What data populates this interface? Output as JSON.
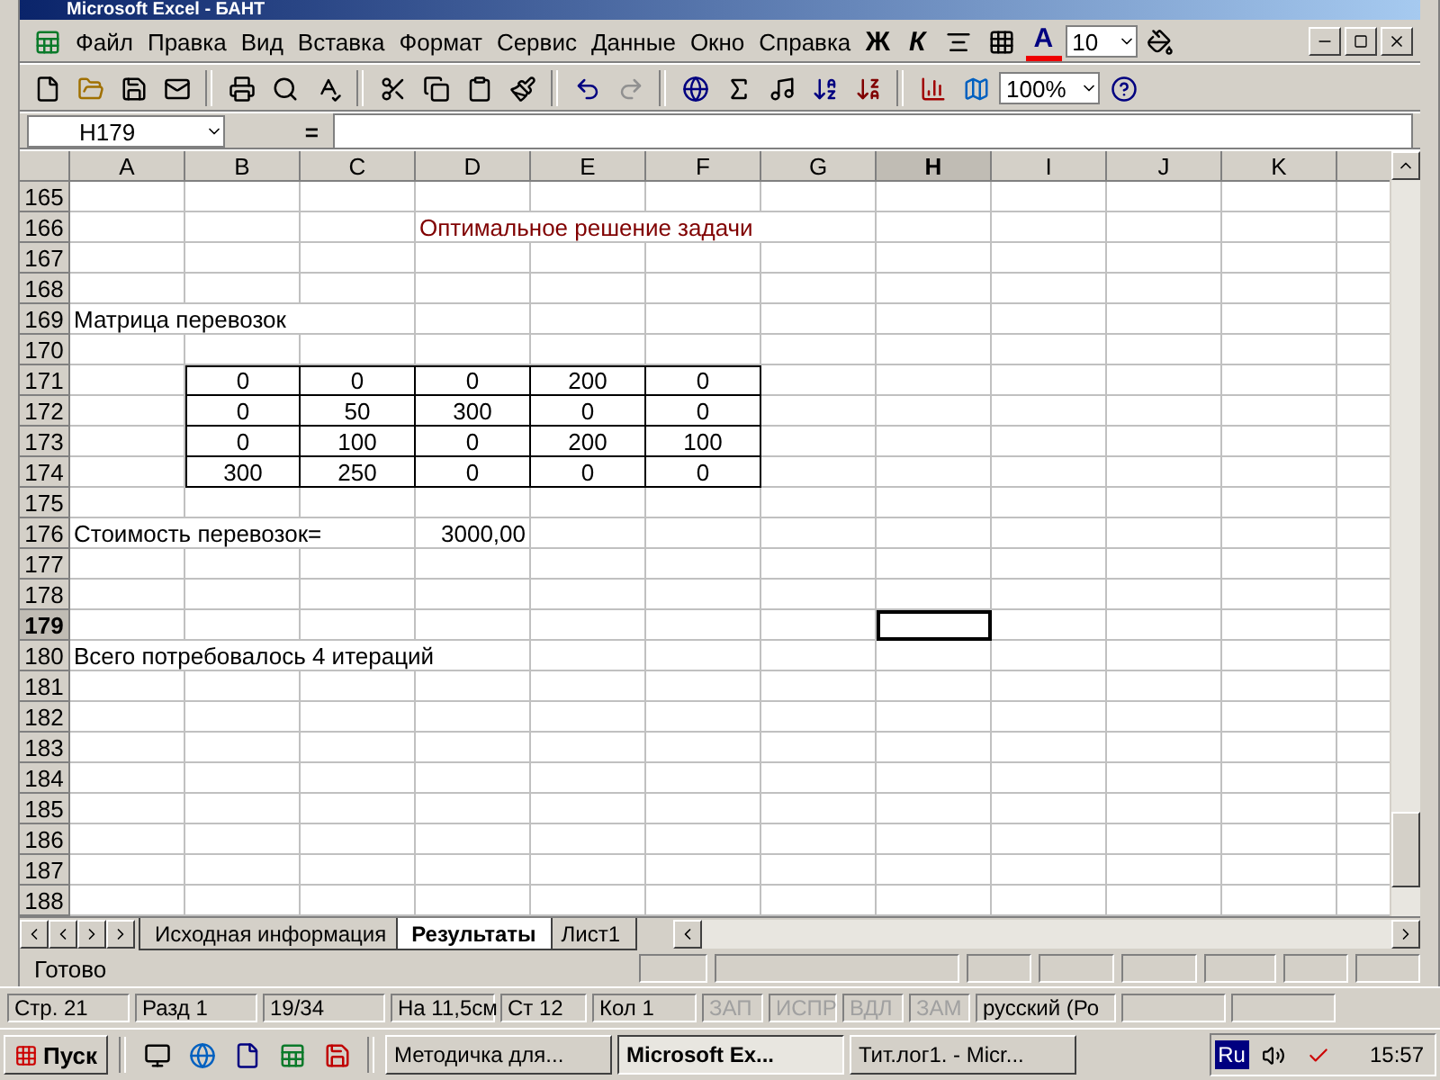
{
  "window": {
    "title": "Microsoft Excel - БАНТ"
  },
  "menu": [
    "Файл",
    "Правка",
    "Вид",
    "Вставка",
    "Формат",
    "Сервис",
    "Данные",
    "Окно",
    "Справка"
  ],
  "format_toolbar": {
    "bold": "Ж",
    "italic": "К",
    "font_color": "A",
    "font_size": "10"
  },
  "standard_toolbar": {
    "zoom": "100%"
  },
  "formula_bar": {
    "name_box": "H179",
    "equals": "="
  },
  "columns": [
    {
      "label": "A",
      "selected": false
    },
    {
      "label": "B",
      "selected": false
    },
    {
      "label": "C",
      "selected": false
    },
    {
      "label": "D",
      "selected": false
    },
    {
      "label": "E",
      "selected": false
    },
    {
      "label": "F",
      "selected": false
    },
    {
      "label": "G",
      "selected": false
    },
    {
      "label": "H",
      "selected": true
    },
    {
      "label": "I",
      "selected": false
    },
    {
      "label": "J",
      "selected": false
    },
    {
      "label": "K",
      "selected": false
    }
  ],
  "rows": [
    {
      "number": "165",
      "selected": false,
      "cells": [
        {
          "kind": "empty"
        },
        {
          "kind": "empty"
        },
        {
          "kind": "empty"
        },
        {
          "kind": "empty"
        },
        {
          "kind": "empty"
        },
        {
          "kind": "empty"
        },
        {
          "kind": "empty"
        },
        {
          "kind": "empty"
        },
        {
          "kind": "empty"
        },
        {
          "kind": "empty"
        },
        {
          "kind": "empty"
        }
      ]
    },
    {
      "number": "166",
      "selected": false,
      "cells": [
        {
          "kind": "empty"
        },
        {
          "kind": "empty"
        },
        {
          "kind": "empty"
        },
        {
          "kind": "heading",
          "text": "Оптимальное решение задачи"
        },
        {
          "kind": "empty"
        },
        {
          "kind": "empty"
        },
        {
          "kind": "empty"
        },
        {
          "kind": "empty"
        },
        {
          "kind": "empty"
        },
        {
          "kind": "empty"
        },
        {
          "kind": "empty"
        }
      ]
    },
    {
      "number": "167",
      "selected": false,
      "cells": [
        {
          "kind": "empty"
        },
        {
          "kind": "empty"
        },
        {
          "kind": "empty"
        },
        {
          "kind": "empty"
        },
        {
          "kind": "empty"
        },
        {
          "kind": "empty"
        },
        {
          "kind": "empty"
        },
        {
          "kind": "empty"
        },
        {
          "kind": "empty"
        },
        {
          "kind": "empty"
        },
        {
          "kind": "empty"
        }
      ]
    },
    {
      "number": "168",
      "selected": false,
      "cells": [
        {
          "kind": "empty"
        },
        {
          "kind": "empty"
        },
        {
          "kind": "empty"
        },
        {
          "kind": "empty"
        },
        {
          "kind": "empty"
        },
        {
          "kind": "empty"
        },
        {
          "kind": "empty"
        },
        {
          "kind": "empty"
        },
        {
          "kind": "empty"
        },
        {
          "kind": "empty"
        },
        {
          "kind": "empty"
        }
      ]
    },
    {
      "number": "169",
      "selected": false,
      "cells": [
        {
          "kind": "label",
          "text": "Матрица перевозок"
        },
        {
          "kind": "empty"
        },
        {
          "kind": "empty"
        },
        {
          "kind": "empty"
        },
        {
          "kind": "empty"
        },
        {
          "kind": "empty"
        },
        {
          "kind": "empty"
        },
        {
          "kind": "empty"
        },
        {
          "kind": "empty"
        },
        {
          "kind": "empty"
        },
        {
          "kind": "empty"
        }
      ]
    },
    {
      "number": "170",
      "selected": false,
      "cells": [
        {
          "kind": "empty"
        },
        {
          "kind": "empty"
        },
        {
          "kind": "empty"
        },
        {
          "kind": "empty"
        },
        {
          "kind": "empty"
        },
        {
          "kind": "empty"
        },
        {
          "kind": "empty"
        },
        {
          "kind": "empty"
        },
        {
          "kind": "empty"
        },
        {
          "kind": "empty"
        },
        {
          "kind": "empty"
        }
      ]
    },
    {
      "number": "171",
      "selected": false,
      "cells": [
        {
          "kind": "empty"
        },
        {
          "kind": "matrix",
          "text": "0"
        },
        {
          "kind": "matrix",
          "text": "0"
        },
        {
          "kind": "matrix",
          "text": "0"
        },
        {
          "kind": "matrix",
          "text": "200"
        },
        {
          "kind": "matrix",
          "text": "0"
        },
        {
          "kind": "empty"
        },
        {
          "kind": "empty"
        },
        {
          "kind": "empty"
        },
        {
          "kind": "empty"
        },
        {
          "kind": "empty"
        }
      ]
    },
    {
      "number": "172",
      "selected": false,
      "cells": [
        {
          "kind": "empty"
        },
        {
          "kind": "matrix",
          "text": "0"
        },
        {
          "kind": "matrix",
          "text": "50"
        },
        {
          "kind": "matrix",
          "text": "300"
        },
        {
          "kind": "matrix",
          "text": "0"
        },
        {
          "kind": "matrix",
          "text": "0"
        },
        {
          "kind": "empty"
        },
        {
          "kind": "empty"
        },
        {
          "kind": "empty"
        },
        {
          "kind": "empty"
        },
        {
          "kind": "empty"
        }
      ]
    },
    {
      "number": "173",
      "selected": false,
      "cells": [
        {
          "kind": "empty"
        },
        {
          "kind": "matrix",
          "text": "0"
        },
        {
          "kind": "matrix",
          "text": "100"
        },
        {
          "kind": "matrix",
          "text": "0"
        },
        {
          "kind": "matrix",
          "text": "200"
        },
        {
          "kind": "matrix",
          "text": "100"
        },
        {
          "kind": "empty"
        },
        {
          "kind": "empty"
        },
        {
          "kind": "empty"
        },
        {
          "kind": "empty"
        },
        {
          "kind": "empty"
        }
      ]
    },
    {
      "number": "174",
      "selected": false,
      "cells": [
        {
          "kind": "empty"
        },
        {
          "kind": "matrix",
          "text": "300"
        },
        {
          "kind": "matrix",
          "text": "250"
        },
        {
          "kind": "matrix",
          "text": "0"
        },
        {
          "kind": "matrix",
          "text": "0"
        },
        {
          "kind": "matrix",
          "text": "0"
        },
        {
          "kind": "empty"
        },
        {
          "kind": "empty"
        },
        {
          "kind": "empty"
        },
        {
          "kind": "empty"
        },
        {
          "kind": "empty"
        }
      ]
    },
    {
      "number": "175",
      "selected": false,
      "cells": [
        {
          "kind": "empty"
        },
        {
          "kind": "empty"
        },
        {
          "kind": "empty"
        },
        {
          "kind": "empty"
        },
        {
          "kind": "empty"
        },
        {
          "kind": "empty"
        },
        {
          "kind": "empty"
        },
        {
          "kind": "empty"
        },
        {
          "kind": "empty"
        },
        {
          "kind": "empty"
        },
        {
          "kind": "empty"
        }
      ]
    },
    {
      "number": "176",
      "selected": false,
      "cells": [
        {
          "kind": "label",
          "text": "Стоимость перевозок="
        },
        {
          "kind": "empty"
        },
        {
          "kind": "empty"
        },
        {
          "kind": "number",
          "text": "3000,00"
        },
        {
          "kind": "empty"
        },
        {
          "kind": "empty"
        },
        {
          "kind": "empty"
        },
        {
          "kind": "empty"
        },
        {
          "kind": "empty"
        },
        {
          "kind": "empty"
        },
        {
          "kind": "empty"
        }
      ]
    },
    {
      "number": "177",
      "selected": false,
      "cells": [
        {
          "kind": "empty"
        },
        {
          "kind": "empty"
        },
        {
          "kind": "empty"
        },
        {
          "kind": "empty"
        },
        {
          "kind": "empty"
        },
        {
          "kind": "empty"
        },
        {
          "kind": "empty"
        },
        {
          "kind": "empty"
        },
        {
          "kind": "empty"
        },
        {
          "kind": "empty"
        },
        {
          "kind": "empty"
        }
      ]
    },
    {
      "number": "178",
      "selected": false,
      "cells": [
        {
          "kind": "empty"
        },
        {
          "kind": "empty"
        },
        {
          "kind": "empty"
        },
        {
          "kind": "empty"
        },
        {
          "kind": "empty"
        },
        {
          "kind": "empty"
        },
        {
          "kind": "empty"
        },
        {
          "kind": "empty"
        },
        {
          "kind": "empty"
        },
        {
          "kind": "empty"
        },
        {
          "kind": "empty"
        }
      ]
    },
    {
      "number": "179",
      "selected": true,
      "cells": [
        {
          "kind": "empty"
        },
        {
          "kind": "empty"
        },
        {
          "kind": "empty"
        },
        {
          "kind": "empty"
        },
        {
          "kind": "empty"
        },
        {
          "kind": "empty"
        },
        {
          "kind": "empty"
        },
        {
          "kind": "empty"
        },
        {
          "kind": "empty"
        },
        {
          "kind": "empty"
        },
        {
          "kind": "empty"
        }
      ]
    },
    {
      "number": "180",
      "selected": false,
      "cells": [
        {
          "kind": "label",
          "text": "Всего потребовалось  4 итераций"
        },
        {
          "kind": "empty"
        },
        {
          "kind": "empty"
        },
        {
          "kind": "empty"
        },
        {
          "kind": "empty"
        },
        {
          "kind": "empty"
        },
        {
          "kind": "empty"
        },
        {
          "kind": "empty"
        },
        {
          "kind": "empty"
        },
        {
          "kind": "empty"
        },
        {
          "kind": "empty"
        }
      ]
    },
    {
      "number": "181",
      "selected": false,
      "cells": [
        {
          "kind": "empty"
        },
        {
          "kind": "empty"
        },
        {
          "kind": "empty"
        },
        {
          "kind": "empty"
        },
        {
          "kind": "empty"
        },
        {
          "kind": "empty"
        },
        {
          "kind": "empty"
        },
        {
          "kind": "empty"
        },
        {
          "kind": "empty"
        },
        {
          "kind": "empty"
        },
        {
          "kind": "empty"
        }
      ]
    },
    {
      "number": "182",
      "selected": false,
      "cells": [
        {
          "kind": "empty"
        },
        {
          "kind": "empty"
        },
        {
          "kind": "empty"
        },
        {
          "kind": "empty"
        },
        {
          "kind": "empty"
        },
        {
          "kind": "empty"
        },
        {
          "kind": "empty"
        },
        {
          "kind": "empty"
        },
        {
          "kind": "empty"
        },
        {
          "kind": "empty"
        },
        {
          "kind": "empty"
        }
      ]
    },
    {
      "number": "183",
      "selected": false,
      "cells": [
        {
          "kind": "empty"
        },
        {
          "kind": "empty"
        },
        {
          "kind": "empty"
        },
        {
          "kind": "empty"
        },
        {
          "kind": "empty"
        },
        {
          "kind": "empty"
        },
        {
          "kind": "empty"
        },
        {
          "kind": "empty"
        },
        {
          "kind": "empty"
        },
        {
          "kind": "empty"
        },
        {
          "kind": "empty"
        }
      ]
    },
    {
      "number": "184",
      "selected": false,
      "cells": [
        {
          "kind": "empty"
        },
        {
          "kind": "empty"
        },
        {
          "kind": "empty"
        },
        {
          "kind": "empty"
        },
        {
          "kind": "empty"
        },
        {
          "kind": "empty"
        },
        {
          "kind": "empty"
        },
        {
          "kind": "empty"
        },
        {
          "kind": "empty"
        },
        {
          "kind": "empty"
        },
        {
          "kind": "empty"
        }
      ]
    },
    {
      "number": "185",
      "selected": false,
      "cells": [
        {
          "kind": "empty"
        },
        {
          "kind": "empty"
        },
        {
          "kind": "empty"
        },
        {
          "kind": "empty"
        },
        {
          "kind": "empty"
        },
        {
          "kind": "empty"
        },
        {
          "kind": "empty"
        },
        {
          "kind": "empty"
        },
        {
          "kind": "empty"
        },
        {
          "kind": "empty"
        },
        {
          "kind": "empty"
        }
      ]
    },
    {
      "number": "186",
      "selected": false,
      "cells": [
        {
          "kind": "empty"
        },
        {
          "kind": "empty"
        },
        {
          "kind": "empty"
        },
        {
          "kind": "empty"
        },
        {
          "kind": "empty"
        },
        {
          "kind": "empty"
        },
        {
          "kind": "empty"
        },
        {
          "kind": "empty"
        },
        {
          "kind": "empty"
        },
        {
          "kind": "empty"
        },
        {
          "kind": "empty"
        }
      ]
    },
    {
      "number": "187",
      "selected": false,
      "cells": [
        {
          "kind": "empty"
        },
        {
          "kind": "empty"
        },
        {
          "kind": "empty"
        },
        {
          "kind": "empty"
        },
        {
          "kind": "empty"
        },
        {
          "kind": "empty"
        },
        {
          "kind": "empty"
        },
        {
          "kind": "empty"
        },
        {
          "kind": "empty"
        },
        {
          "kind": "empty"
        },
        {
          "kind": "empty"
        }
      ]
    },
    {
      "number": "188",
      "selected": false,
      "cells": [
        {
          "kind": "empty"
        },
        {
          "kind": "empty"
        },
        {
          "kind": "empty"
        },
        {
          "kind": "empty"
        },
        {
          "kind": "empty"
        },
        {
          "kind": "empty"
        },
        {
          "kind": "empty"
        },
        {
          "kind": "empty"
        },
        {
          "kind": "empty"
        },
        {
          "kind": "empty"
        },
        {
          "kind": "empty"
        }
      ]
    }
  ],
  "sheet_tabs": [
    {
      "label": "Исходная информация",
      "selected": false
    },
    {
      "label": "Результаты",
      "selected": true
    },
    {
      "label": "Лист1",
      "selected": false
    }
  ],
  "status_bar": {
    "text": "Готово"
  },
  "word_status_bar": {
    "fields": [
      {
        "text": "Стр. 21",
        "disabled": false
      },
      {
        "text": "Разд 1",
        "disabled": false
      },
      {
        "text": "19/34",
        "disabled": false
      },
      {
        "text": "На 11,5см",
        "disabled": false
      },
      {
        "text": "Ст 12",
        "disabled": false
      },
      {
        "text": "Кол 1",
        "disabled": false
      },
      {
        "text": "ЗАП",
        "disabled": true
      },
      {
        "text": "ИСПР",
        "disabled": true
      },
      {
        "text": "ВДЛ",
        "disabled": true
      },
      {
        "text": "ЗАМ",
        "disabled": true
      },
      {
        "text": "русский (Ро",
        "disabled": false
      }
    ]
  },
  "taskbar": {
    "start": "Пуск",
    "tasks": [
      {
        "label": "Методичка для...",
        "selected": false
      },
      {
        "label": "Microsoft Ex...",
        "selected": true
      },
      {
        "label": "Тит.лог1. - Micr...",
        "selected": false
      }
    ],
    "language": "Ru",
    "clock": "15:57"
  }
}
